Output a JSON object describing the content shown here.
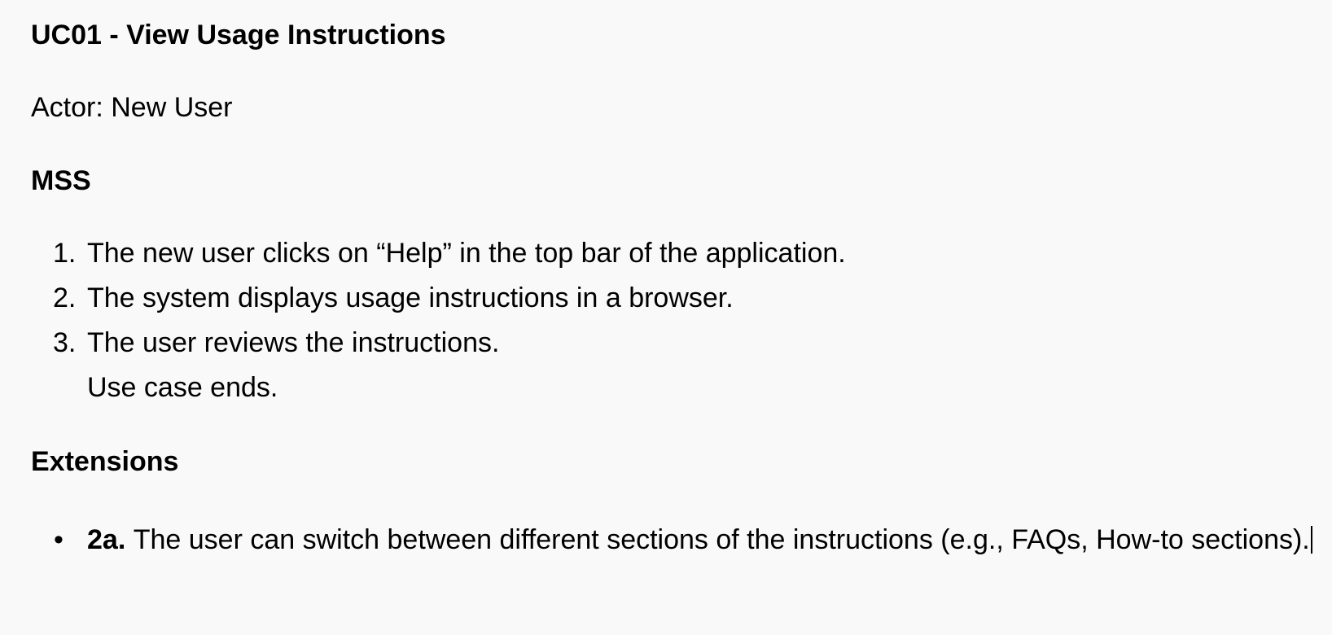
{
  "document": {
    "title": "UC01 - View Usage Instructions",
    "actor": "Actor: New User",
    "mss": {
      "heading": "MSS",
      "steps": [
        {
          "number": "1.",
          "text": "The new user clicks on “Help” in the top bar of the application."
        },
        {
          "number": "2.",
          "text": "The system displays usage instructions in a browser."
        },
        {
          "number": "3.",
          "text": "The user reviews the instructions."
        }
      ],
      "end": "Use case ends."
    },
    "extensions": {
      "heading": "Extensions",
      "bullet": "•",
      "items": [
        {
          "id": "2a.",
          "text": "The user can switch between different sections of the instructions (e.g., FAQs, How-to sections)."
        }
      ]
    }
  }
}
